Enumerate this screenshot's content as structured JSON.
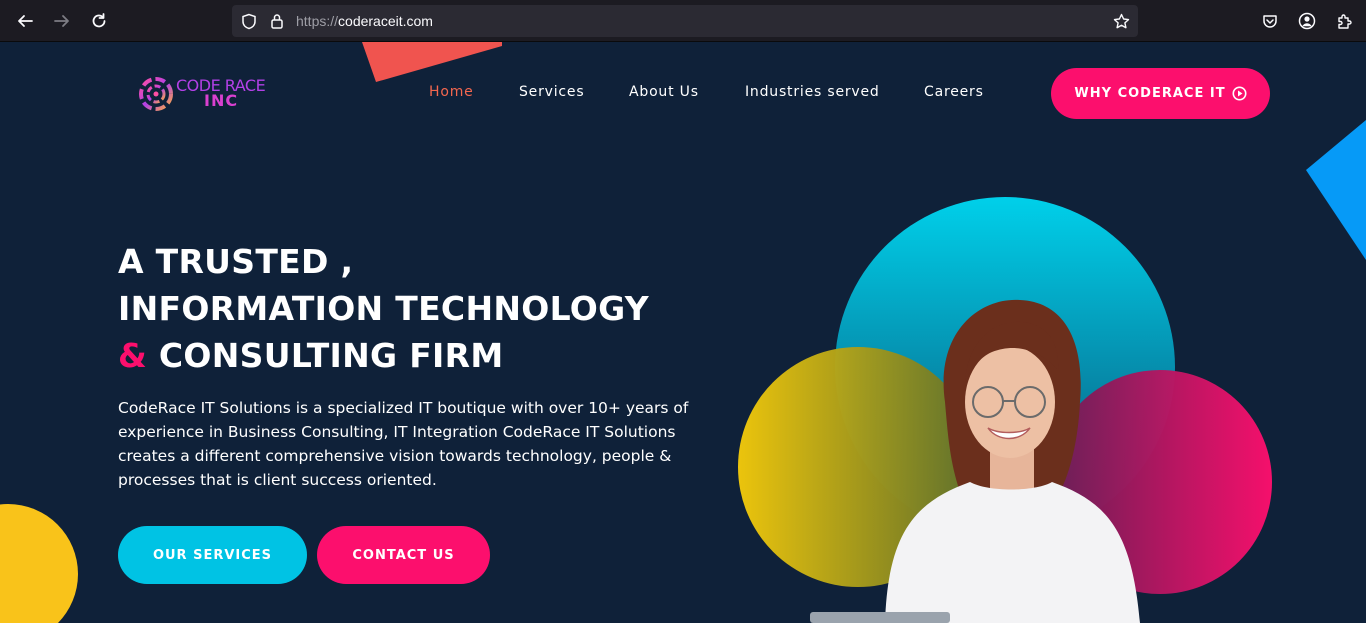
{
  "browser": {
    "url_protocol": "https://",
    "url_host": "coderaceit.com"
  },
  "logo": {
    "line1": "CODE RACE",
    "line2": "INC"
  },
  "nav": {
    "items": [
      {
        "label": "Home",
        "active": true
      },
      {
        "label": "Services",
        "active": false
      },
      {
        "label": "About Us",
        "active": false
      },
      {
        "label": "Industries served",
        "active": false
      },
      {
        "label": "Careers",
        "active": false
      }
    ],
    "cta_label": "WHY CODERACE IT",
    "cta_icon": "play-circle-icon"
  },
  "hero": {
    "headline_line1": "A TRUSTED ,",
    "headline_line2": "INFORMATION TECHNOLOGY",
    "headline_amp": "&",
    "headline_line3": "CONSULTING FIRM",
    "description": "CodeRace IT Solutions is a specialized IT boutique with over 10+ years of experience in Business Consulting, IT Integration CodeRace IT Solutions creates a different comprehensive vision towards technology, people & processes that is client success oriented.",
    "primary_button": "OUR SERVICES",
    "secondary_button": "CONTACT US"
  },
  "colors": {
    "background": "#0f2139",
    "accent_pink": "#fc0f6d",
    "accent_cyan": "#00c3e4",
    "accent_yellow": "#f9c31a",
    "active_nav": "#f4674f"
  }
}
